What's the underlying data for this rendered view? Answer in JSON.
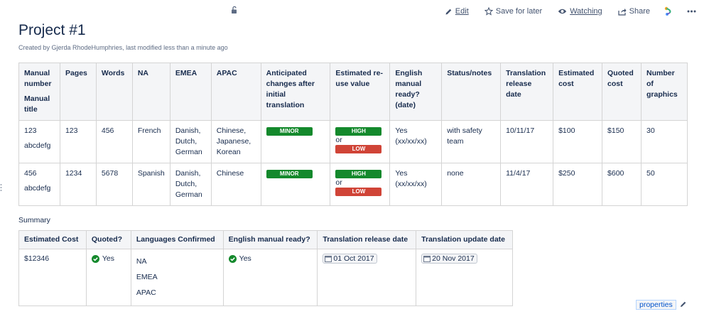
{
  "toolbar": {
    "edit": "Edit",
    "save_for_later": "Save for later",
    "watching": "Watching",
    "share": "Share",
    "icons": [
      "lock-icon",
      "pencil-icon",
      "star-icon",
      "eye-icon",
      "share-icon",
      "app-icon",
      "more-icon"
    ]
  },
  "page": {
    "title": "Project #1",
    "byline": "Created by Gjerda RhodeHumphries, last modified less than a minute ago"
  },
  "main_table": {
    "headers": {
      "manual_number": "Manual number",
      "manual_title": "Manual title",
      "pages": "Pages",
      "words": "Words",
      "na": "NA",
      "emea": "EMEA",
      "apac": "APAC",
      "anticipated": "Anticipated changes after initial translation",
      "reuse": "Estimated re-use value",
      "english_ready": "English manual ready? (date)",
      "status": "Status/notes",
      "release": "Translation release date",
      "est_cost": "Estimated cost",
      "quoted_cost": "Quoted cost",
      "graphics": "Number of graphics"
    },
    "rows": [
      {
        "number": "123",
        "title": "abcdefg",
        "pages": "123",
        "words": "456",
        "na": "French",
        "emea": "Danish, Dutch, German",
        "apac": "Chinese, Japanese, Korean",
        "anticipated": "MINOR",
        "reuse_high": "HIGH",
        "reuse_or": "or",
        "reuse_low": "LOW",
        "english_ready": "Yes (xx/xx/xx)",
        "status": "with safety team",
        "release": "10/11/17",
        "est_cost": "$100",
        "quoted_cost": "$150",
        "graphics": "30"
      },
      {
        "number": "456",
        "title": "abcdefg",
        "pages": "1234",
        "words": "5678",
        "na": "Spanish",
        "emea": "Danish, Dutch, German",
        "apac": "Chinese",
        "anticipated": "MINOR",
        "reuse_high": "HIGH",
        "reuse_or": "or",
        "reuse_low": "LOW",
        "english_ready": "Yes (xx/xx/xx)",
        "status": "none",
        "release": "11/4/17",
        "est_cost": "$250",
        "quoted_cost": "$600",
        "graphics": "50"
      }
    ]
  },
  "summary": {
    "label": "Summary",
    "headers": {
      "estimated_cost": "Estimated Cost",
      "quoted": "Quoted?",
      "languages": "Languages Confirmed",
      "english_ready": "English manual ready?",
      "release_date": "Translation release date",
      "update_date": "Translation update date"
    },
    "row": {
      "estimated_cost": "$12346",
      "quoted": "Yes",
      "languages": [
        "NA",
        "EMEA",
        "APAC"
      ],
      "english_ready": "Yes",
      "release_date": "01 Oct 2017",
      "update_date": "20 Nov 2017"
    }
  },
  "footer": {
    "properties_label": "properties"
  },
  "colors": {
    "lozenge_green": "#14892c",
    "lozenge_red": "#d04437",
    "check_green": "#14892c",
    "header_bg": "#f4f5f7",
    "text": "#172b4d"
  }
}
